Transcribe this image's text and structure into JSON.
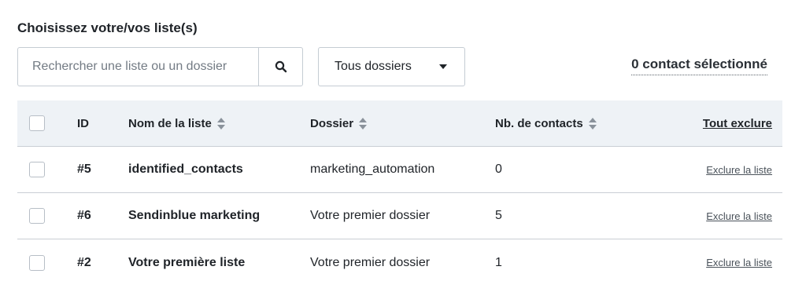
{
  "title": "Choisissez votre/vos liste(s)",
  "search": {
    "placeholder": "Rechercher une liste ou un dossier",
    "icon": "search-icon"
  },
  "folder_filter": {
    "selected": "Tous dossiers"
  },
  "selection_status": "0 contact sélectionné",
  "table": {
    "headers": {
      "id": "ID",
      "name": "Nom de la liste",
      "folder": "Dossier",
      "count": "Nb. de contacts",
      "exclude_all": "Tout exclure"
    },
    "rows": [
      {
        "id": "#5",
        "name": "identified_contacts",
        "folder": "marketing_automation",
        "count": "0",
        "action": "Exclure la liste"
      },
      {
        "id": "#6",
        "name": "Sendinblue marketing",
        "folder": "Votre premier dossier",
        "count": "5",
        "action": "Exclure la liste"
      },
      {
        "id": "#2",
        "name": "Votre première liste",
        "folder": "Votre premier dossier",
        "count": "1",
        "action": "Exclure la liste"
      }
    ]
  }
}
